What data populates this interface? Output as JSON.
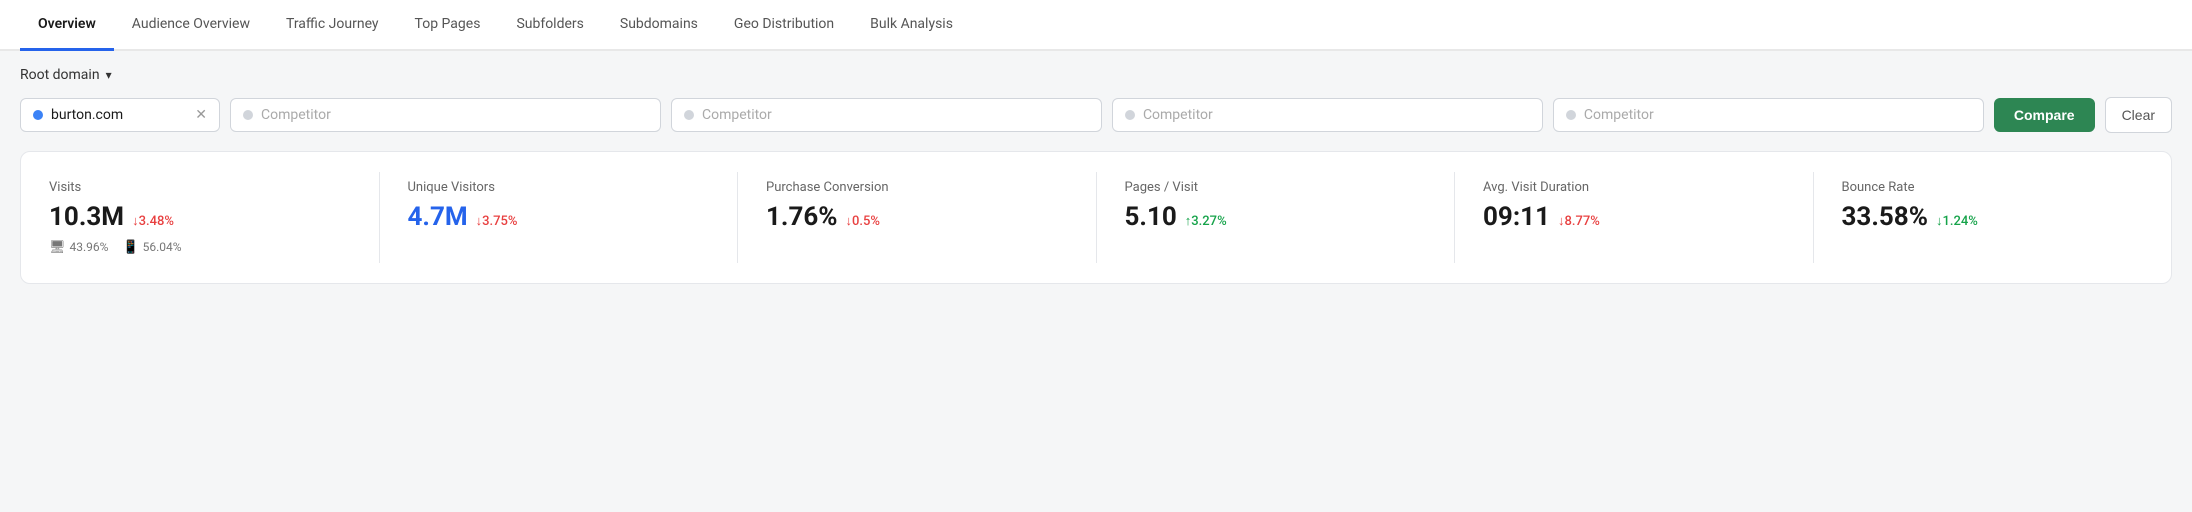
{
  "nav": {
    "items": [
      {
        "label": "Overview",
        "active": true
      },
      {
        "label": "Audience Overview",
        "active": false
      },
      {
        "label": "Traffic Journey",
        "active": false
      },
      {
        "label": "Top Pages",
        "active": false
      },
      {
        "label": "Subfolders",
        "active": false
      },
      {
        "label": "Subdomains",
        "active": false
      },
      {
        "label": "Geo Distribution",
        "active": false
      },
      {
        "label": "Bulk Analysis",
        "active": false
      }
    ]
  },
  "filter": {
    "root_domain_label": "Root domain",
    "domain": "burton.com",
    "competitors": [
      "Competitor",
      "Competitor",
      "Competitor",
      "Competitor"
    ],
    "compare_btn": "Compare",
    "clear_btn": "Clear"
  },
  "stats": [
    {
      "label": "Visits",
      "value": "10.3M",
      "blue": false,
      "change": "↓3.48%",
      "change_type": "down",
      "sub_desktop": "43.96%",
      "sub_mobile": "56.04%"
    },
    {
      "label": "Unique Visitors",
      "value": "4.7M",
      "blue": true,
      "change": "↓3.75%",
      "change_type": "down",
      "sub_desktop": null,
      "sub_mobile": null
    },
    {
      "label": "Purchase Conversion",
      "value": "1.76%",
      "blue": false,
      "change": "↓0.5%",
      "change_type": "down",
      "sub_desktop": null,
      "sub_mobile": null
    },
    {
      "label": "Pages / Visit",
      "value": "5.10",
      "blue": false,
      "change": "↑3.27%",
      "change_type": "up",
      "sub_desktop": null,
      "sub_mobile": null
    },
    {
      "label": "Avg. Visit Duration",
      "value": "09:11",
      "blue": false,
      "change": "↓8.77%",
      "change_type": "down",
      "sub_desktop": null,
      "sub_mobile": null
    },
    {
      "label": "Bounce Rate",
      "value": "33.58%",
      "blue": false,
      "change": "↓1.24%",
      "change_type": "up",
      "sub_desktop": null,
      "sub_mobile": null
    }
  ]
}
